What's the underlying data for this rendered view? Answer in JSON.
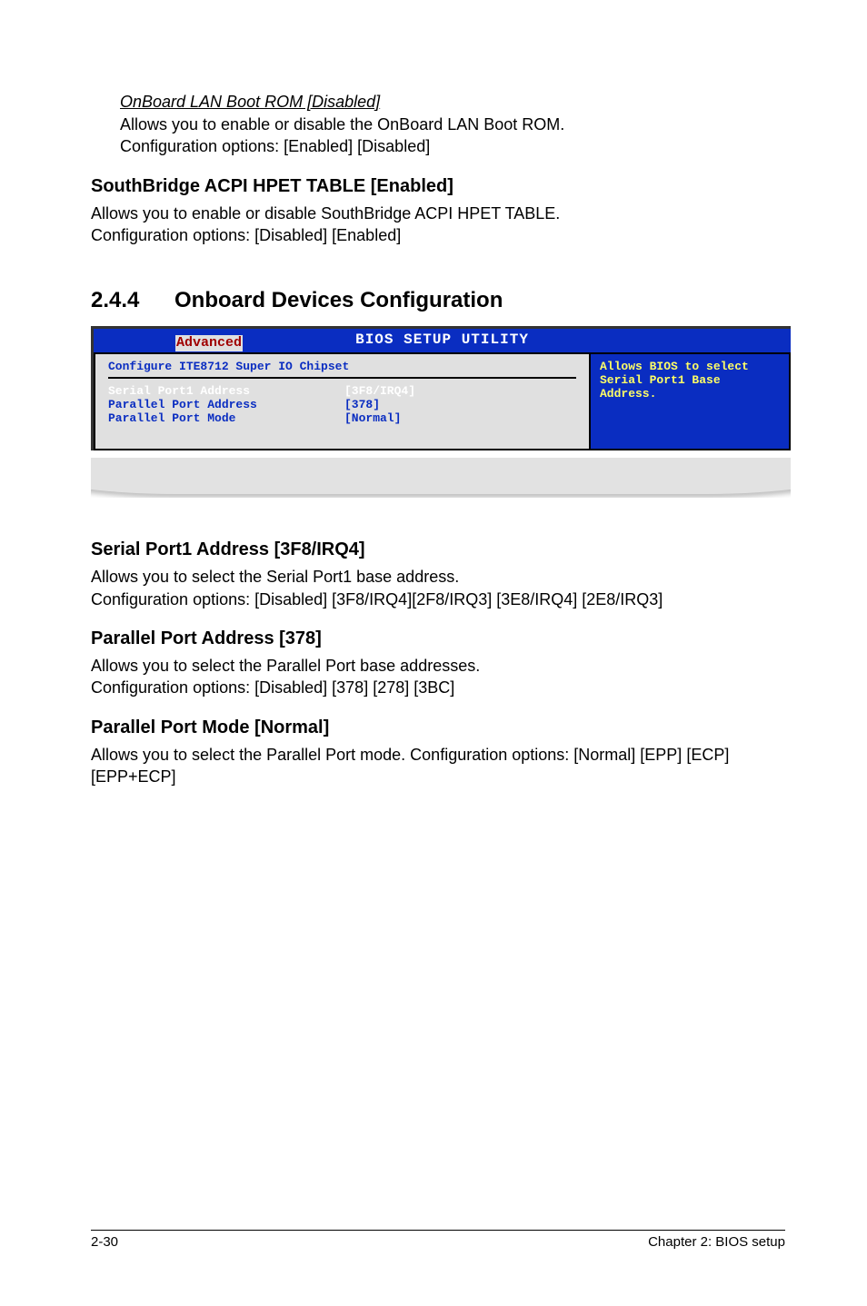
{
  "intro": {
    "onboard_lan_heading": "OnBoard LAN Boot ROM [Disabled]",
    "onboard_lan_line1": "Allows you to enable or disable the OnBoard LAN Boot ROM.",
    "onboard_lan_line2": "Configuration options: [Enabled] [Disabled]"
  },
  "southbridge": {
    "heading": "SouthBridge ACPI HPET TABLE [Enabled]",
    "line1": "Allows you to enable or disable SouthBridge ACPI HPET TABLE.",
    "line2": "Configuration options: [Disabled] [Enabled]"
  },
  "section": {
    "number": "2.4.4",
    "title": "Onboard Devices Configuration"
  },
  "bios": {
    "title": "BIOS SETUP UTILITY",
    "tab": "Advanced",
    "panel_heading": "Configure ITE8712 Super IO Chipset",
    "rows": [
      {
        "label": "Serial Port1 Address",
        "value": "[3F8/IRQ4]"
      },
      {
        "label": "Parallel Port Address",
        "value": "[378]"
      },
      {
        "label": "Parallel Port Mode",
        "value": "[Normal]"
      }
    ],
    "help": "Allows BIOS to select Serial Port1 Base Address."
  },
  "serial": {
    "heading": "Serial Port1 Address [3F8/IRQ4]",
    "line1": "Allows you to select the Serial Port1 base address.",
    "line2": "Configuration options: [Disabled] [3F8/IRQ4][2F8/IRQ3] [3E8/IRQ4] [2E8/IRQ3]"
  },
  "parallel_addr": {
    "heading": "Parallel Port Address [378]",
    "line1": "Allows you to select the Parallel Port base addresses.",
    "line2": "Configuration options: [Disabled] [378] [278] [3BC]"
  },
  "parallel_mode": {
    "heading": "Parallel Port Mode [Normal]",
    "line1": "Allows you to select the Parallel Port  mode. Configuration options: [Normal] [EPP] [ECP] [EPP+ECP]"
  },
  "footer": {
    "left": "2-30",
    "right": "Chapter 2: BIOS setup"
  }
}
